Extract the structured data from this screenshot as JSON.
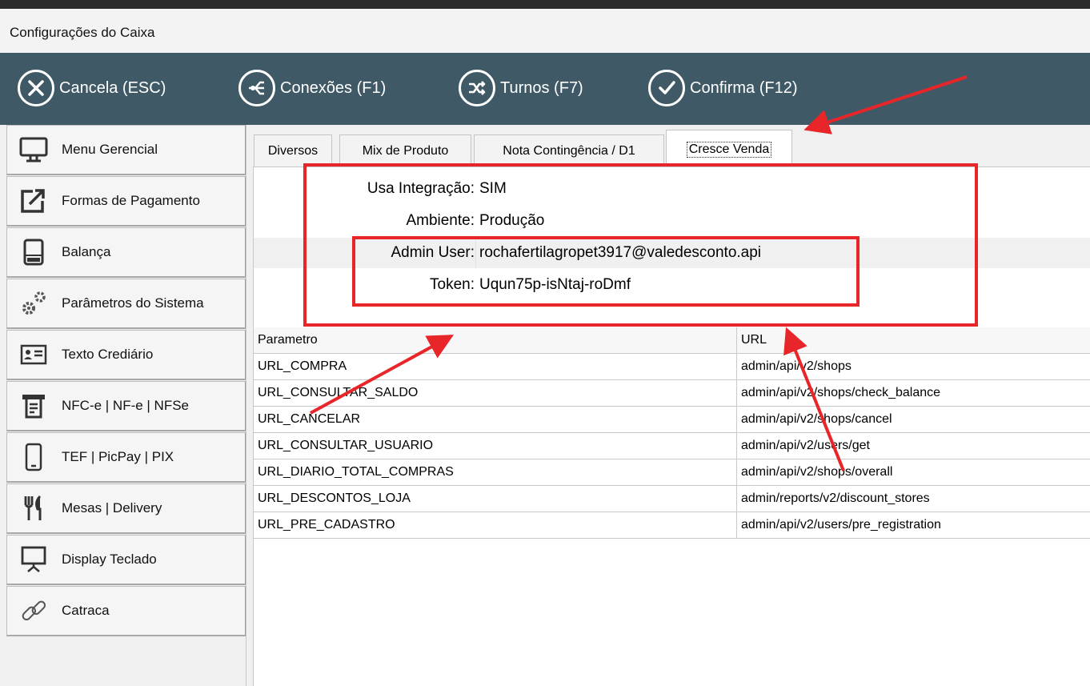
{
  "window": {
    "title": "Configurações do Caixa"
  },
  "toolbar": {
    "buttons": [
      {
        "label": "Cancela (ESC)",
        "icon": "close-icon"
      },
      {
        "label": "Conexões (F1)",
        "icon": "network-icon"
      },
      {
        "label": "Turnos (F7)",
        "icon": "shuffle-icon"
      },
      {
        "label": "Confirma (F12)",
        "icon": "check-icon"
      }
    ]
  },
  "sidebar": {
    "items": [
      {
        "label": "Menu Gerencial",
        "icon": "monitor-icon"
      },
      {
        "label": "Formas de Pagamento",
        "icon": "external-link-icon"
      },
      {
        "label": "Balança",
        "icon": "scale-icon"
      },
      {
        "label": "Parâmetros do Sistema",
        "icon": "gears-icon"
      },
      {
        "label": "Texto Crediário",
        "icon": "id-card-icon"
      },
      {
        "label": "NFC-e | NF-e | NFSe",
        "icon": "receipt-printer-icon"
      },
      {
        "label": "TEF | PicPay | PIX",
        "icon": "phone-icon"
      },
      {
        "label": "Mesas | Delivery",
        "icon": "cutlery-icon"
      },
      {
        "label": "Display Teclado",
        "icon": "presentation-icon"
      },
      {
        "label": "Catraca",
        "icon": "link-icon"
      }
    ]
  },
  "tabs": [
    {
      "label": "Diversos"
    },
    {
      "label": "Mix de Produto"
    },
    {
      "label": "Nota Contingência / D1"
    },
    {
      "label": "Cresce Venda",
      "active": true
    }
  ],
  "properties": [
    {
      "label": "Usa Integração:",
      "value": "SIM"
    },
    {
      "label": "Ambiente:",
      "value": "Produção"
    },
    {
      "label": "Admin User:",
      "value": "rochafertilagropet3917@valedesconto.api"
    },
    {
      "label": "Token:",
      "value": "Uqun75p-isNtaj-roDmf"
    }
  ],
  "grid": {
    "headers": [
      "Parametro",
      "URL"
    ],
    "rows": [
      [
        "URL_COMPRA",
        "admin/api/v2/shops"
      ],
      [
        "URL_CONSULTAR_SALDO",
        "admin/api/v2/shops/check_balance"
      ],
      [
        "URL_CANCELAR",
        "admin/api/v2/shops/cancel"
      ],
      [
        "URL_CONSULTAR_USUARIO",
        "admin/api/v2/users/get"
      ],
      [
        "URL_DIARIO_TOTAL_COMPRAS",
        "admin/api/v2/shops/overall"
      ],
      [
        "URL_DESCONTOS_LOJA",
        "admin/reports/v2/discount_stores"
      ],
      [
        "URL_PRE_CADASTRO",
        "admin/api/v2/users/pre_registration"
      ]
    ]
  },
  "colors": {
    "toolbar": "#3f5a66",
    "annotation": "#e8262a"
  }
}
